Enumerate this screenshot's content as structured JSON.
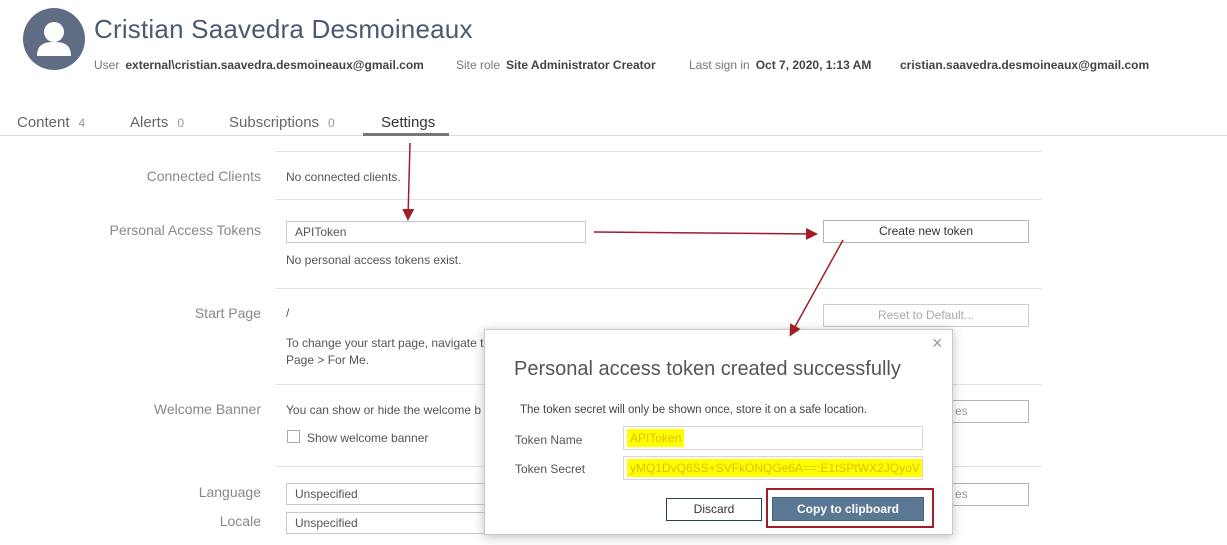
{
  "header": {
    "name": "Cristian Saavedra Desmoineaux",
    "user_label": "User",
    "user_value": "external\\cristian.saavedra.desmoineaux@gmail.com",
    "role_label": "Site role",
    "role_value": "Site Administrator Creator",
    "signin_label": "Last sign in",
    "signin_value": "Oct 7, 2020, 1:13 AM",
    "email": "cristian.saavedra.desmoineaux@gmail.com"
  },
  "tabs": [
    {
      "label": "Content",
      "count": "4"
    },
    {
      "label": "Alerts",
      "count": "0"
    },
    {
      "label": "Subscriptions",
      "count": "0"
    },
    {
      "label": "Settings",
      "count": ""
    }
  ],
  "settings": {
    "connected_clients": {
      "label": "Connected Clients",
      "text": "No connected clients."
    },
    "tokens": {
      "label": "Personal Access Tokens",
      "input_value": "APIToken",
      "create_button": "Create new token",
      "empty_text": "No personal access tokens exist."
    },
    "start_page": {
      "label": "Start Page",
      "value": "/",
      "help_line1": "To change your start page, navigate t",
      "help_line2": "Page > For Me.",
      "reset_button": "Reset to Default..."
    },
    "welcome_banner": {
      "label": "Welcome Banner",
      "text": "You can show or hide the welcome b",
      "checkbox_label": "Show welcome banner",
      "button_fragment": "es"
    },
    "language": {
      "label": "Language",
      "value": "Unspecified",
      "button_fragment": "es"
    },
    "locale": {
      "label": "Locale",
      "value": "Unspecified"
    }
  },
  "dialog": {
    "close": "×",
    "title": "Personal access token created successfully",
    "note": "The token secret will only be shown once, store it on a safe location.",
    "name_label": "Token Name",
    "name_value": "APIToken",
    "secret_label": "Token Secret",
    "secret_value": "yMQ1DvQ6SS+SVFkONQGe6A==:E1tSPtWX2JQyoV",
    "discard": "Discard",
    "copy": "Copy to clipboard"
  },
  "colors": {
    "accent": "#5a7793",
    "annotation_red": "#a01e28",
    "highlight": "#ffff00",
    "avatar": "#5e6d83"
  }
}
